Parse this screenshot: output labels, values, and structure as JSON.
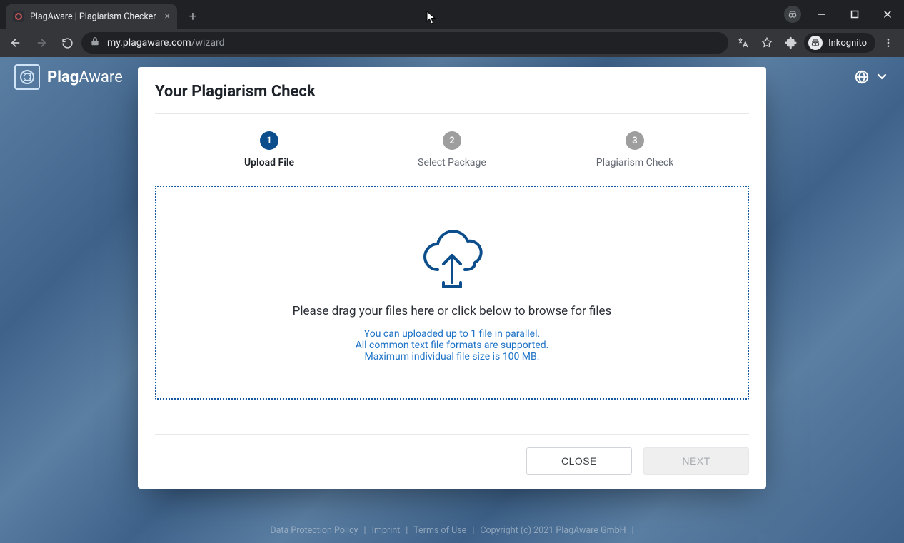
{
  "browser": {
    "tab_title": "PlagAware | Plagiarism Checker",
    "url_host": "my.plagaware.com",
    "url_path": "/wizard",
    "profile_label": "Inkognito"
  },
  "logo": {
    "text_a": "Plag",
    "text_b": "Aware"
  },
  "dialog": {
    "title": "Your Plagiarism Check",
    "steps": [
      {
        "num": "1",
        "label": "Upload File"
      },
      {
        "num": "2",
        "label": "Select Package"
      },
      {
        "num": "3",
        "label": "Plagiarism Check"
      }
    ],
    "dropzone": {
      "main": "Please drag your files here or click below to browse for files",
      "line1": "You can uploaded up to 1 file in parallel.",
      "line2": "All common text file formats are supported.",
      "line3": "Maximum individual file size is 100 MB."
    },
    "close_label": "CLOSE",
    "next_label": "NEXT"
  },
  "footer": {
    "a": "Data Protection Policy",
    "b": "Imprint",
    "c": "Terms of Use",
    "d": "Copyright (c) 2021 PlagAware GmbH",
    "sep": "|"
  }
}
